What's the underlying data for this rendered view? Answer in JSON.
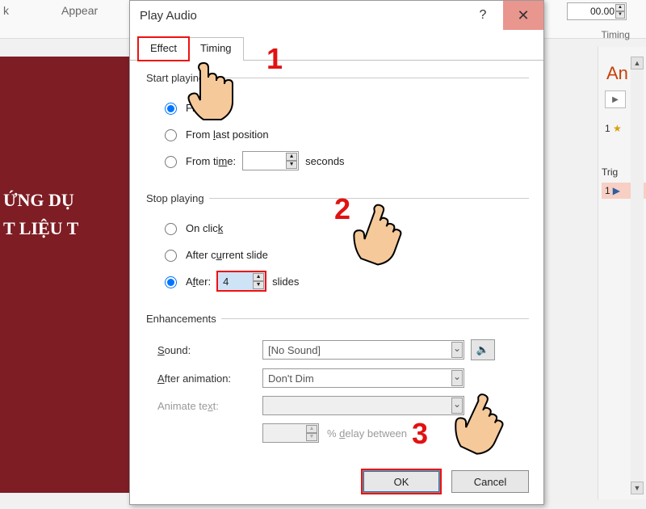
{
  "background": {
    "ribbon_word1": "k",
    "ribbon_word2": "Appear",
    "spin_value": "00.00",
    "timing_label": "Timing",
    "slide_text": "ỨNG DỤ\nT LIỆU T",
    "pane_header": "An",
    "pane_item1_prefix": "1",
    "pane_item1_star": "★",
    "pane_trigger_label": "Trig",
    "pane_item2_prefix": "1"
  },
  "dialog": {
    "title": "Play Audio",
    "help_symbol": "?",
    "close_symbol": "✕",
    "tabs": {
      "effect": "Effect",
      "timing": "Timing"
    },
    "group_start": "Start playing",
    "start_from_beginning": "From",
    "start_from_last": "From last position",
    "start_from_time": "From time:",
    "start_time_value": "",
    "seconds_label": "seconds",
    "group_stop": "Stop playing",
    "stop_on_click": "On click",
    "stop_after_current": "After current slide",
    "stop_after": "After:",
    "stop_after_value": "4",
    "slides_label": "slides",
    "group_enh": "Enhancements",
    "sound_label": "Sound:",
    "sound_value": "[No Sound]",
    "after_anim_label": "After animation:",
    "after_anim_value": "Don't Dim",
    "animate_text_label": "Animate text:",
    "animate_text_value": "",
    "delay_value": "",
    "delay_label": "% delay between",
    "ok": "OK",
    "cancel": "Cancel"
  },
  "annotations": {
    "n1": "1",
    "n2": "2",
    "n3": "3"
  }
}
